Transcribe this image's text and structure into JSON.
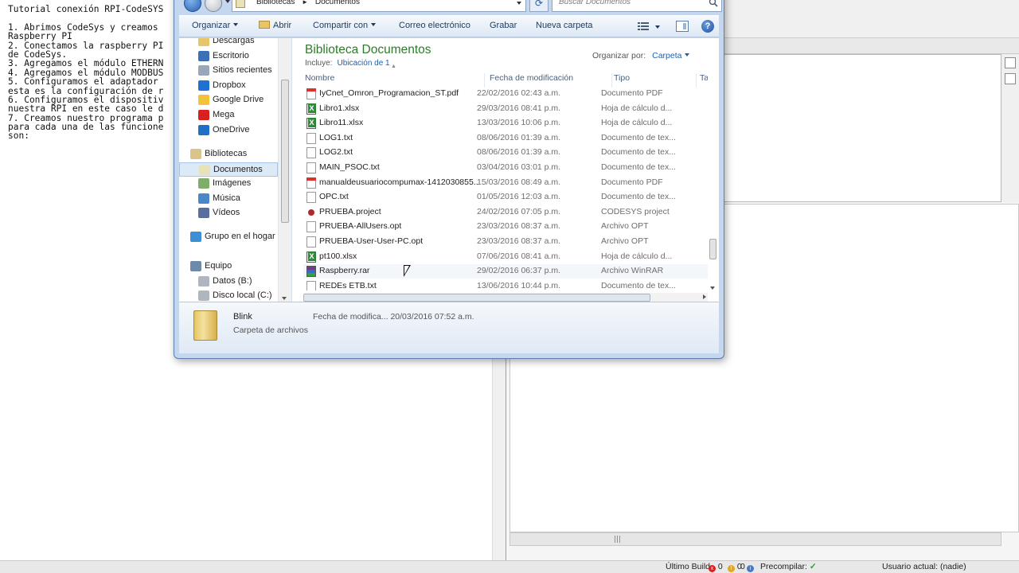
{
  "notepad": {
    "lines": [
      "Tutorial conexión RPI-CodeSYS",
      "",
      "1. Abrimos CodeSys y creamos",
      "Raspberry PI",
      "2. Conectamos la raspberry PI",
      "de CodeSys.",
      "3. Agregamos el módulo ETHERN",
      "4. Agregamos el módulo MODBUS",
      "5. Configuramos el adaptador",
      "esta es la configuración de r",
      "6. Configuramos el dispositiv",
      "nuestra RPI en este caso le d",
      "7. Creamos nuestro programa p",
      "para cada una de las funcione",
      "son:"
    ]
  },
  "statusbar": {
    "last_build": "Último Build",
    "errors": "0",
    "warnings": "0",
    "messages": "0",
    "precompile": "Precompilar:",
    "current_user": "Usuario actual: (nadie)"
  },
  "dialog": {
    "address": {
      "path1": "Bibliotecas",
      "sep": "►",
      "path2": "Documentos"
    },
    "search_placeholder": "Buscar Documentos",
    "toolbar": {
      "organize": "Organizar",
      "open": "Abrir",
      "share": "Compartir con",
      "email": "Correo electrónico",
      "burn": "Grabar",
      "new_folder": "Nueva carpeta"
    },
    "nav": {
      "favorites": [
        "Descargas",
        "Escritorio",
        "Sitios recientes",
        "Dropbox",
        "Google Drive",
        "Mega",
        "OneDrive"
      ],
      "libraries": "Bibliotecas",
      "library_items": [
        "Documentos",
        "Imágenes",
        "Música",
        "Vídeos"
      ],
      "homegroup": "Grupo en el hogar",
      "computer": "Equipo",
      "drives": [
        "Datos (B:)",
        "Disco local (C:)"
      ]
    },
    "library": {
      "title": "Biblioteca Documentos",
      "includes_label": "Incluye:",
      "includes_link": "Ubicación de 1",
      "arrange_label": "Organizar por:",
      "arrange_value": "Carpeta"
    },
    "columns": {
      "name": "Nombre",
      "modified": "Fecha de modificación",
      "type": "Tipo",
      "size": "Ta"
    },
    "files": [
      {
        "name": "IyCnet_Omron_Programacion_ST.pdf",
        "date": "22/02/2016 02:43 a.m.",
        "type": "Documento PDF",
        "icon": "pdf"
      },
      {
        "name": "Libro1.xlsx",
        "date": "29/03/2016 08:41 p.m.",
        "type": "Hoja de cálculo d...",
        "icon": "xlsx"
      },
      {
        "name": "Libro11.xlsx",
        "date": "13/03/2016 10:06 p.m.",
        "type": "Hoja de cálculo d...",
        "icon": "xlsx"
      },
      {
        "name": "LOG1.txt",
        "date": "08/06/2016 01:39 a.m.",
        "type": "Documento de tex...",
        "icon": "txt"
      },
      {
        "name": "LOG2.txt",
        "date": "08/06/2016 01:39 a.m.",
        "type": "Documento de tex...",
        "icon": "txt"
      },
      {
        "name": "MAIN_PSOC.txt",
        "date": "03/04/2016 03:01 p.m.",
        "type": "Documento de tex...",
        "icon": "txt"
      },
      {
        "name": "manualdeusuariocompumax-1412030855...",
        "date": "15/03/2016 08:49 a.m.",
        "type": "Documento PDF",
        "icon": "pdf"
      },
      {
        "name": "OPC.txt",
        "date": "01/05/2016 12:03 a.m.",
        "type": "Documento de tex...",
        "icon": "txt"
      },
      {
        "name": "PRUEBA.project",
        "date": "24/02/2016 07:05 p.m.",
        "type": "CODESYS project",
        "icon": "proj"
      },
      {
        "name": "PRUEBA-AllUsers.opt",
        "date": "23/03/2016 08:37 a.m.",
        "type": "Archivo OPT",
        "icon": "txt"
      },
      {
        "name": "PRUEBA-User-User-PC.opt",
        "date": "23/03/2016 08:37 a.m.",
        "type": "Archivo OPT",
        "icon": "txt"
      },
      {
        "name": "pt100.xlsx",
        "date": "07/06/2016 08:41 a.m.",
        "type": "Hoja de cálculo d...",
        "icon": "xlsx"
      },
      {
        "name": "Raspberry.rar",
        "date": "29/02/2016 06:37 p.m.",
        "type": "Archivo WinRAR",
        "icon": "rar"
      },
      {
        "name": "REDEs ETB.txt",
        "date": "13/06/2016 10:44 p.m.",
        "type": "Documento de tex...",
        "icon": "txt"
      }
    ],
    "details": {
      "name": "Blink",
      "type": "Carpeta de archivos",
      "modified": "Fecha de modifica... 20/03/2016 07:52 a.m."
    }
  }
}
